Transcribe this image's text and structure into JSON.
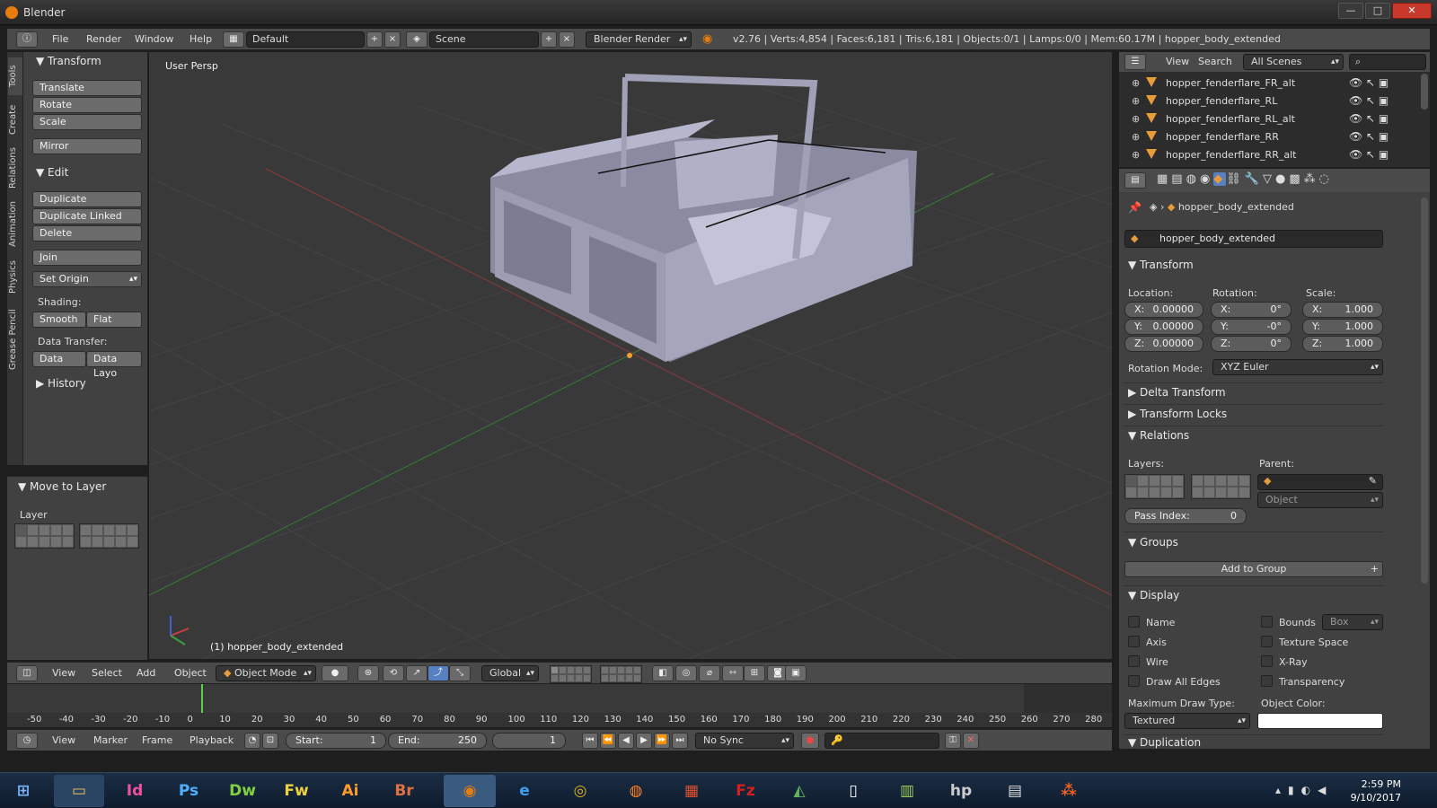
{
  "window": {
    "title": "Blender",
    "min": "—",
    "max": "□",
    "close": "✕"
  },
  "infobar": {
    "menus": [
      "File",
      "Render",
      "Window",
      "Help"
    ],
    "screen": "Default",
    "scene": "Scene",
    "engine": "Blender Render",
    "stats": "v2.76 | Verts:4,854 | Faces:6,181 | Tris:6,181 | Objects:0/1 | Lamps:0/0 | Mem:60.17M | hopper_body_extended"
  },
  "tool_tabs": [
    "Tools",
    "Create",
    "Relations",
    "Animation",
    "Physics",
    "Grease Pencil"
  ],
  "tools": {
    "transform_title": "Transform",
    "translate": "Translate",
    "rotate": "Rotate",
    "scale": "Scale",
    "mirror": "Mirror",
    "edit_title": "Edit",
    "duplicate": "Duplicate",
    "duplicate_linked": "Duplicate Linked",
    "delete": "Delete",
    "join": "Join",
    "set_origin": "Set Origin",
    "shading_label": "Shading:",
    "smooth": "Smooth",
    "flat": "Flat",
    "data_transfer_label": "Data Transfer:",
    "data": "Data",
    "data_layo": "Data Layo",
    "history_title": "History"
  },
  "move_to_layer": {
    "title": "Move to Layer",
    "layer_label": "Layer"
  },
  "viewport": {
    "view_label": "User Persp",
    "object_label": "(1) hopper_body_extended"
  },
  "viewport_header": {
    "menus": [
      "View",
      "Select",
      "Add",
      "Object"
    ],
    "mode": "Object Mode",
    "orientation": "Global"
  },
  "timeline": {
    "ticks": [
      "-50",
      "-40",
      "-30",
      "-20",
      "-10",
      "0",
      "10",
      "20",
      "30",
      "40",
      "50",
      "60",
      "70",
      "80",
      "90",
      "100",
      "110",
      "120",
      "130",
      "140",
      "150",
      "160",
      "170",
      "180",
      "190",
      "200",
      "210",
      "220",
      "230",
      "240",
      "250",
      "260",
      "270",
      "280"
    ],
    "menus": [
      "View",
      "Marker",
      "Frame",
      "Playback"
    ],
    "start_label": "Start:",
    "start": "1",
    "end_label": "End:",
    "end": "250",
    "current": "1",
    "sync": "No Sync"
  },
  "outliner": {
    "menus": [
      "View",
      "Search"
    ],
    "filter": "All Scenes",
    "items": [
      "hopper_fenderflare_FR_alt",
      "hopper_fenderflare_RL",
      "hopper_fenderflare_RL_alt",
      "hopper_fenderflare_RR",
      "hopper_fenderflare_RR_alt"
    ]
  },
  "properties": {
    "breadcrumb": "hopper_body_extended",
    "object_name": "hopper_body_extended",
    "transform": {
      "title": "Transform",
      "location_label": "Location:",
      "rotation_label": "Rotation:",
      "scale_label": "Scale:",
      "loc": {
        "x": "0.00000",
        "y": "0.00000",
        "z": "0.00000"
      },
      "rot": {
        "x": "0°",
        "y": "-0°",
        "z": "0°"
      },
      "scale": {
        "x": "1.000",
        "y": "1.000",
        "z": "1.000"
      },
      "rotation_mode_label": "Rotation Mode:",
      "rotation_mode": "XYZ Euler"
    },
    "delta_transform": "Delta Transform",
    "transform_locks": "Transform Locks",
    "relations": {
      "title": "Relations",
      "layers_label": "Layers:",
      "parent_label": "Parent:",
      "parent_type": "Object",
      "pass_index_label": "Pass Index:",
      "pass_index": "0"
    },
    "groups": {
      "title": "Groups",
      "add": "Add to Group"
    },
    "display": {
      "title": "Display",
      "name": "Name",
      "axis": "Axis",
      "wire": "Wire",
      "draw_all_edges": "Draw All Edges",
      "bounds": "Bounds",
      "bounds_type": "Box",
      "texture_space": "Texture Space",
      "xray": "X-Ray",
      "transparency": "Transparency",
      "max_draw_label": "Maximum Draw Type:",
      "max_draw": "Textured",
      "object_color_label": "Object Color:"
    },
    "duplication": "Duplication"
  },
  "taskbar": {
    "apps": [
      "Id",
      "Ps",
      "Dw",
      "Fw",
      "Ai",
      "Br"
    ],
    "time": "2:59 PM",
    "date": "9/10/2017"
  }
}
